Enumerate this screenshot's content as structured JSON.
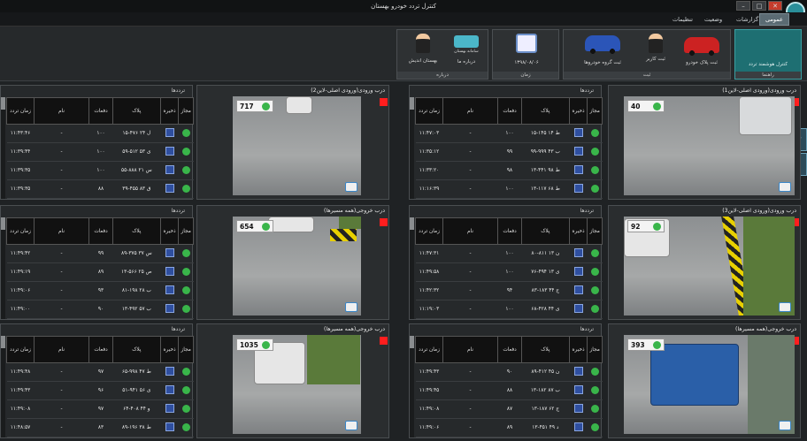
{
  "window": {
    "title": "کنترل تردد خودرو بهستان",
    "btn_min": "–",
    "btn_max": "□",
    "btn_close": "✕"
  },
  "menu": {
    "items": [
      {
        "label": "عمومی",
        "active": true
      },
      {
        "label": "گزارشات",
        "active": false
      },
      {
        "label": "وضعیت",
        "active": false
      },
      {
        "label": "تنظیمات",
        "active": false
      }
    ]
  },
  "ribbon": {
    "home": {
      "line1": "کنترل هوشمند تردد",
      "line2": "راهنما",
      "label": "راهنما"
    },
    "group_sabt": {
      "label": "ثبت",
      "btn1": "ثبت پلاک خودرو",
      "btn2": "ثبت کاربر",
      "btn3": "ثبت گروه خودروها"
    },
    "group_zaman": {
      "label": "زمان",
      "date": "۱۳۹۸/۰۸/۰۶"
    },
    "group_darbare": {
      "label": "درباره",
      "btn1": "درباره ما",
      "btn2": "بهستان اندیش",
      "brand": "سامانه بهستان"
    }
  },
  "table_headers": {
    "mojaz": "مجاز",
    "zakhire": "ذخیره",
    "pelak": "پلاک",
    "dafat": "دفعات",
    "nam": "نام",
    "zaman": "زمان تردد",
    "panel_title": "ترددها"
  },
  "rows": [
    {
      "camA": {
        "title": "درب ورودی(ورودی اصلی-لاین1)",
        "count": "40"
      },
      "panelA": [
        {
          "plate": "۱۵-۱۴۵ ط ۱۴",
          "dafat": "۱۰۰",
          "nam": "-",
          "time": "۱۱:۴۷:۰۳"
        },
        {
          "plate": "۹۹-۹۹۹ ب ۴۳",
          "dafat": "۹۹",
          "nam": "-",
          "time": "۱۱:۳۵:۱۲"
        },
        {
          "plate": "۱۳-۴۴۱ ط ۹۸",
          "dafat": "۹۸",
          "nam": "-",
          "time": "۱۱:۳۳:۲۰"
        },
        {
          "plate": "۱۳-۱۱۷ ط ۶۸",
          "dafat": "۱۰۰",
          "nam": "-",
          "time": "۱۱:۱۶:۳۹"
        }
      ],
      "camB": {
        "title": "درب ورودی(ورودی اصلی-لاین2)",
        "count": "717"
      },
      "panelB": [
        {
          "plate": "۱۵-۴۷۶ ل ۲۴",
          "dafat": "۱۰۰",
          "nam": "-",
          "time": "۱۱:۴۳:۴۶"
        },
        {
          "plate": "۵۹-۵۱۲ ی ۵۳",
          "dafat": "۱۰۰",
          "nam": "-",
          "time": "۱۱:۳۹:۴۴"
        },
        {
          "plate": "۵۵-۸۸۸ س ۲۱",
          "dafat": "۱۰۰",
          "nam": "-",
          "time": "۱۱:۳۹:۳۵"
        },
        {
          "plate": "۳۹-۴۵۵ ق ۸۳",
          "dafat": "۸۸",
          "nam": "-",
          "time": "۱۱:۳۹:۳۵"
        }
      ]
    },
    {
      "camA": {
        "title": "درب ورودی(ورودی اصلی-لاین3)",
        "count": "92"
      },
      "panelA": [
        {
          "plate": "۸۰-۸۱۱ ن ۱۳",
          "dafat": "۱۰۰",
          "nam": "-",
          "time": "۱۱:۴۷:۳۱"
        },
        {
          "plate": "۷۶-۴۹۴ ی ۱۳",
          "dafat": "۱۰۰",
          "nam": "-",
          "time": "۱۱:۴۹:۵۸"
        },
        {
          "plate": "۸۳-۱۸۳ ج ۴۴",
          "dafat": "۹۴",
          "nam": "-",
          "time": "۱۱:۴۲:۳۲"
        },
        {
          "plate": "۶۸-۴۲۸ ی ۴۴",
          "dafat": "۱۰۰",
          "nam": "-",
          "time": "۱۱:۱۹:۰۳"
        }
      ],
      "camB": {
        "title": "درب خروجی(همه مسیرها)",
        "count": "654"
      },
      "panelB": [
        {
          "plate": "۸۹-۳۷۵ س ۳۷",
          "dafat": "۹۹",
          "nam": "-",
          "time": "۱۱:۴۹:۴۲"
        },
        {
          "plate": "۱۳-۵۶۶ ص ۲۵",
          "dafat": "۸۹",
          "nam": "-",
          "time": "۱۱:۴۹:۱۹"
        },
        {
          "plate": "۸۱-۱۹۸ ب ۲۸",
          "dafat": "۹۳",
          "nam": "-",
          "time": "۱۱:۴۹:۰۶"
        },
        {
          "plate": "۱۳-۴۹۲ ب ۵۷",
          "dafat": "۹۰",
          "nam": "-",
          "time": "۱۱:۴۹:۰۰"
        }
      ]
    },
    {
      "camA": {
        "title": "درب خروجی(همه مسیرها)",
        "count": "393"
      },
      "panelA": [
        {
          "plate": "۸۹-۴۱۲ ن ۴۵",
          "dafat": "۹۰",
          "nam": "-",
          "time": "۱۱:۴۹:۴۳"
        },
        {
          "plate": "۱۳-۱۸۲ ب ۸۷",
          "dafat": "۸۸",
          "nam": "-",
          "time": "۱۱:۴۹:۴۵"
        },
        {
          "plate": "۱۳-۱۸۷ ج ۶۲",
          "dafat": "۸۷",
          "nam": "-",
          "time": "۱۱:۴۹:۰۸"
        },
        {
          "plate": "۱۳-۴۵۱ د ۴۹",
          "dafat": "۸۹",
          "nam": "-",
          "time": "۱۱:۴۹:۰۶"
        }
      ],
      "camB": {
        "title": "درب خروجی(همه مسیرها)",
        "count": "1035"
      },
      "panelB": [
        {
          "plate": "۶۵-۹۹۸ ط ۴۷",
          "dafat": "۹۷",
          "nam": "-",
          "time": "۱۱:۴۹:۴۸"
        },
        {
          "plate": "۵۱-۹۴۱ ی ۵۶",
          "dafat": "۹۶",
          "nam": "-",
          "time": "۱۱:۴۹:۴۳"
        },
        {
          "plate": "۶۴-۴۰۸ و ۴۴",
          "dafat": "۹۷",
          "nam": "-",
          "time": "۱۱:۴۹:۰۸"
        },
        {
          "plate": "۸۹-۱۹۶ ط ۳۸",
          "dafat": "۸۳",
          "nam": "-",
          "time": "۱۱:۴۸:۵۷"
        }
      ]
    }
  ]
}
